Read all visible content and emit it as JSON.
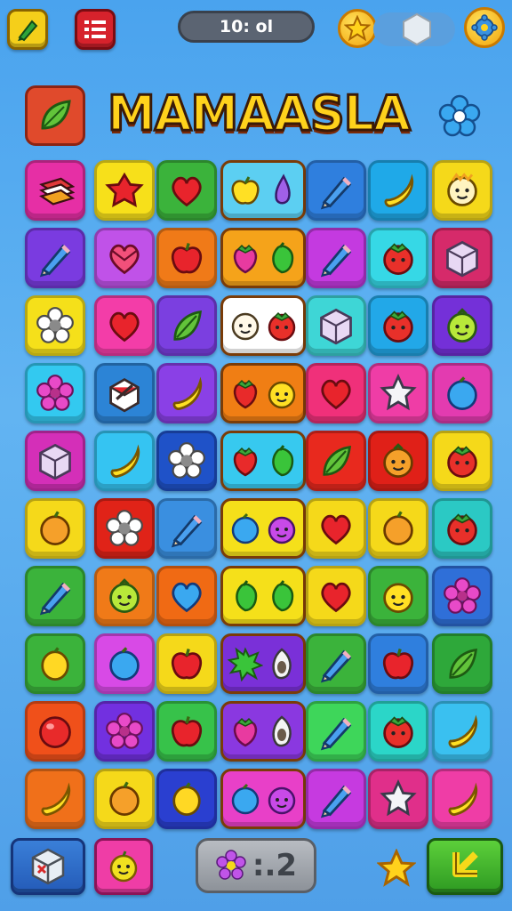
{
  "header": {
    "timer": "10: ol",
    "title": "MAMAASLA"
  },
  "colors": {
    "background": "#56aaf0",
    "title_fill": "#ffd21c",
    "counter": "#a3a7ad"
  },
  "buttons": {
    "top_left": {
      "icon": "pencil-icon",
      "color": "#f5cf1a"
    },
    "menu": {
      "icon": "grid-menu-icon",
      "color": "#d6222c"
    },
    "star": {
      "icon": "star-icon"
    },
    "hexagon": {
      "icon": "hexagon-icon"
    },
    "settings": {
      "icon": "gear-icon"
    },
    "title_tile": {
      "icon": "leaf-icon"
    },
    "title_gear": {
      "icon": "gear-icon"
    },
    "bottom_cube": {
      "icon": "cube-icon"
    },
    "bottom_apple": {
      "icon": "apple-icon"
    },
    "bottom_star": {
      "icon": "star-icon"
    },
    "bottom_next": {
      "icon": "arrow-icon"
    }
  },
  "bottom": {
    "counter_text": ":.2",
    "counter_icon": "flower-icon"
  },
  "board": {
    "rows": 10,
    "cols": 7,
    "cells": [
      [
        {
          "bg": "#e62fa5",
          "icon": "book"
        },
        {
          "bg": "#f7e01a",
          "icon": "gem"
        },
        {
          "bg": "#3bb33b",
          "icon": "heart"
        },
        {
          "bg": "#5ccff2",
          "icon": "fruit-pair",
          "wide": true,
          "icons": [
            "yellow-apple",
            "drop"
          ]
        },
        null,
        {
          "bg": "#2f7fde",
          "icon": "pencil"
        },
        {
          "bg": "#1fa9e8",
          "icon": "banana"
        },
        {
          "bg": "#f5d91a",
          "icon": "face"
        }
      ],
      [
        {
          "bg": "#7a3be0",
          "icon": "pencil"
        },
        {
          "bg": "#c052e8",
          "icon": "heart-gem"
        },
        {
          "bg": "#f07a18",
          "icon": "apple"
        },
        {
          "bg": "#f5a31a",
          "icon": "fruit-pair",
          "wide": true,
          "icons": [
            "strawberry",
            "green-apple"
          ]
        },
        null,
        {
          "bg": "#c43ae0",
          "icon": "pencil"
        },
        {
          "bg": "#36d8e6",
          "icon": "tomato"
        },
        {
          "bg": "#d62a6a",
          "icon": "cube"
        }
      ],
      [
        {
          "bg": "#f5e01a",
          "icon": "flower-white"
        },
        {
          "bg": "#f33da8",
          "icon": "heart"
        },
        {
          "bg": "#7b3fe0",
          "icon": "leaf"
        },
        {
          "bg": "#ffffff",
          "icon": "fruit-pair",
          "wide": true,
          "icons": [
            "face-white",
            "tomato"
          ]
        },
        null,
        {
          "bg": "#3ed6d6",
          "icon": "cube"
        },
        {
          "bg": "#22a8e8",
          "icon": "tomato"
        },
        {
          "bg": "#7430d8",
          "icon": "face-green"
        }
      ],
      [
        {
          "bg": "#33c9f0",
          "icon": "flower-pink"
        },
        {
          "bg": "#2c84d6",
          "icon": "box"
        },
        {
          "bg": "#8a40e6",
          "icon": "banana"
        },
        {
          "bg": "#f07e14",
          "icon": "fruit-pair",
          "wide": true,
          "icons": [
            "strawberry-red",
            "face-yellow"
          ]
        },
        null,
        {
          "bg": "#f0307a",
          "icon": "heart"
        },
        {
          "bg": "#ef3da6",
          "icon": "star-white"
        },
        {
          "bg": "#e33bb0",
          "icon": "berry-blue"
        }
      ],
      [
        {
          "bg": "#d42fb8",
          "icon": "cube"
        },
        {
          "bg": "#35c4f2",
          "icon": "banana"
        },
        {
          "bg": "#1f52c8",
          "icon": "flower-white"
        },
        {
          "bg": "#37c9ef",
          "icon": "fruit-pair",
          "wide": true,
          "icons": [
            "strawberry-red",
            "green-apple"
          ]
        },
        null,
        {
          "bg": "#e8291e",
          "icon": "leaf"
        },
        {
          "bg": "#e02018",
          "icon": "face-orange"
        },
        {
          "bg": "#f5d91a",
          "icon": "tomato"
        }
      ],
      [
        {
          "bg": "#f5d91a",
          "icon": "orange"
        },
        {
          "bg": "#e02318",
          "icon": "flower-white"
        },
        {
          "bg": "#3a8fe0",
          "icon": "pencil"
        },
        {
          "bg": "#f5e01a",
          "icon": "fruit-pair",
          "wide": true,
          "icons": [
            "berry-blue",
            "face-purple"
          ]
        },
        null,
        {
          "bg": "#f5d91a",
          "icon": "heart"
        },
        {
          "bg": "#f5d91a",
          "icon": "orange"
        },
        {
          "bg": "#2bc9c4",
          "icon": "tomato"
        }
      ],
      [
        {
          "bg": "#3bb33b",
          "icon": "pencil"
        },
        {
          "bg": "#f07a18",
          "icon": "face-green"
        },
        {
          "bg": "#f06a14",
          "icon": "heart-blue"
        },
        {
          "bg": "#f5e01a",
          "icon": "fruit-pair",
          "wide": true,
          "icons": [
            "green-apple",
            "green-apple"
          ]
        },
        null,
        {
          "bg": "#f5d91a",
          "icon": "heart"
        },
        {
          "bg": "#3bb33b",
          "icon": "face-yellow"
        },
        {
          "bg": "#2f6fd8",
          "icon": "flower-pink"
        }
      ],
      [
        {
          "bg": "#3bb33b",
          "icon": "lemon"
        },
        {
          "bg": "#d84ae6",
          "icon": "berry-blue"
        },
        {
          "bg": "#f5d91a",
          "icon": "apple"
        },
        {
          "bg": "#7a30d8",
          "icon": "fruit-pair",
          "wide": true,
          "icons": [
            "splash-green",
            "seed"
          ]
        },
        null,
        {
          "bg": "#3bb33b",
          "icon": "pencil"
        },
        {
          "bg": "#2f7fde",
          "icon": "apple"
        },
        {
          "bg": "#2ea83a",
          "icon": "leaf"
        }
      ],
      [
        {
          "bg": "#f0501a",
          "icon": "berry-red"
        },
        {
          "bg": "#7230e0",
          "icon": "flower-pink"
        },
        {
          "bg": "#37c24a",
          "icon": "apple"
        },
        {
          "bg": "#8a38e0",
          "icon": "fruit-pair",
          "wide": true,
          "icons": [
            "strawberry",
            "seed"
          ]
        },
        null,
        {
          "bg": "#3ed65a",
          "icon": "pencil"
        },
        {
          "bg": "#2bd6c8",
          "icon": "tomato"
        },
        {
          "bg": "#3ac0f0",
          "icon": "banana"
        }
      ],
      [
        {
          "bg": "#f0701a",
          "icon": "banana"
        },
        {
          "bg": "#f5d91a",
          "icon": "orange"
        },
        {
          "bg": "#2a3fd0",
          "icon": "lemon"
        },
        {
          "bg": "#e840c8",
          "icon": "fruit-pair",
          "wide": true,
          "icons": [
            "berry-blue",
            "face-purple"
          ]
        },
        null,
        {
          "bg": "#c63ae0",
          "icon": "pencil"
        },
        {
          "bg": "#e02f8a",
          "icon": "star-white"
        },
        {
          "bg": "#ef3da6",
          "icon": "banana"
        }
      ]
    ]
  }
}
